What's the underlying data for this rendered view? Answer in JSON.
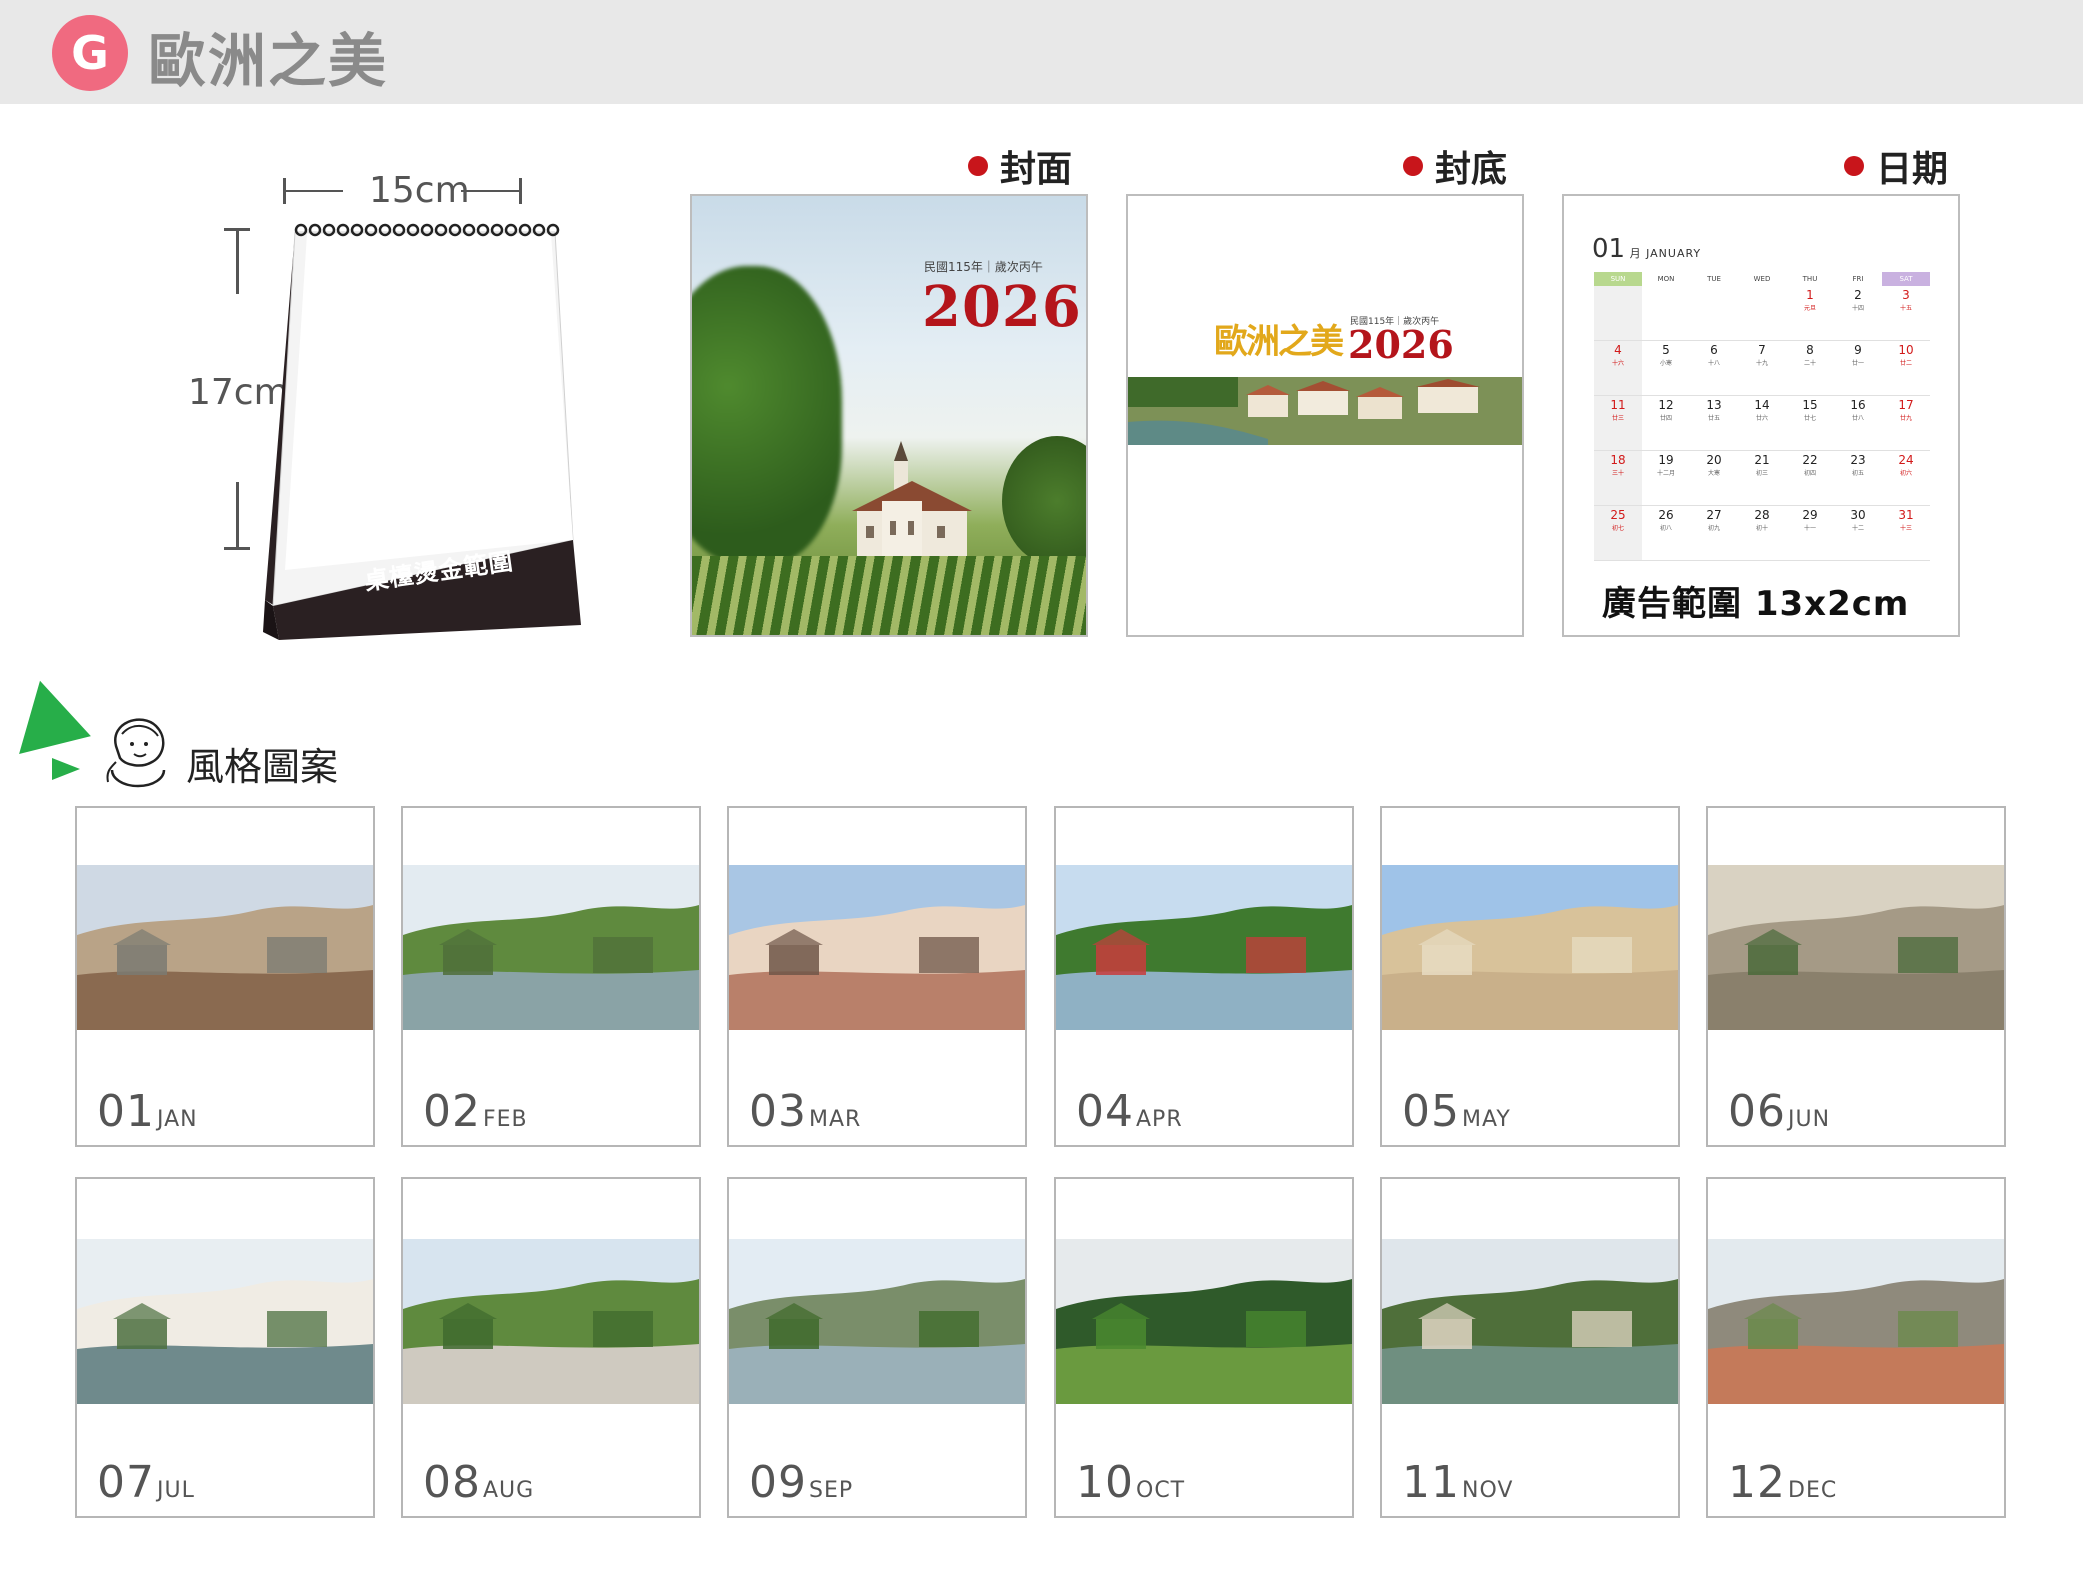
{
  "header": {
    "badge": "G",
    "title": "歐洲之美"
  },
  "dimensions": {
    "width": "15cm",
    "height": "17cm"
  },
  "stand": {
    "label": "桌檯燙金範圍"
  },
  "labels": {
    "cover": "封面",
    "back": "封底",
    "date": "日期"
  },
  "cover": {
    "subtitle": "民國115年｜歲次丙午",
    "year": "2026"
  },
  "back": {
    "brand": "歐洲之美",
    "subtitle": "民國115年｜歲次丙午",
    "year": "2026"
  },
  "date_page": {
    "month_num": "01",
    "month_cn": "月",
    "month_en": "JANUARY",
    "weekdays": [
      "SUN",
      "MON",
      "TUE",
      "WED",
      "THU",
      "FRI",
      "SAT"
    ],
    "weeks": [
      [
        {
          "d": "",
          "l": ""
        },
        {
          "d": "",
          "l": ""
        },
        {
          "d": "",
          "l": ""
        },
        {
          "d": "",
          "l": ""
        },
        {
          "d": "1",
          "l": "元旦",
          "red": true
        },
        {
          "d": "2",
          "l": "十四"
        },
        {
          "d": "3",
          "l": "十五",
          "red": true
        }
      ],
      [
        {
          "d": "4",
          "l": "十六",
          "red": true
        },
        {
          "d": "5",
          "l": "小寒"
        },
        {
          "d": "6",
          "l": "十八"
        },
        {
          "d": "7",
          "l": "十九"
        },
        {
          "d": "8",
          "l": "二十"
        },
        {
          "d": "9",
          "l": "廿一"
        },
        {
          "d": "10",
          "l": "廿二",
          "red": true
        }
      ],
      [
        {
          "d": "11",
          "l": "廿三",
          "red": true
        },
        {
          "d": "12",
          "l": "廿四"
        },
        {
          "d": "13",
          "l": "廿五"
        },
        {
          "d": "14",
          "l": "廿六"
        },
        {
          "d": "15",
          "l": "廿七"
        },
        {
          "d": "16",
          "l": "廿八"
        },
        {
          "d": "17",
          "l": "廿九",
          "red": true
        }
      ],
      [
        {
          "d": "18",
          "l": "三十",
          "red": true
        },
        {
          "d": "19",
          "l": "十二月"
        },
        {
          "d": "20",
          "l": "大寒"
        },
        {
          "d": "21",
          "l": "初三"
        },
        {
          "d": "22",
          "l": "初四"
        },
        {
          "d": "23",
          "l": "初五"
        },
        {
          "d": "24",
          "l": "初六",
          "red": true
        }
      ],
      [
        {
          "d": "25",
          "l": "初七",
          "red": true
        },
        {
          "d": "26",
          "l": "初八"
        },
        {
          "d": "27",
          "l": "初九"
        },
        {
          "d": "28",
          "l": "初十"
        },
        {
          "d": "29",
          "l": "十一"
        },
        {
          "d": "30",
          "l": "十二"
        },
        {
          "d": "31",
          "l": "十三",
          "red": true
        }
      ]
    ],
    "ad": "廣告範圍 13x2cm"
  },
  "style": {
    "title": "風格圖案"
  },
  "months": [
    {
      "num": "01",
      "abbr": "JAN"
    },
    {
      "num": "02",
      "abbr": "FEB"
    },
    {
      "num": "03",
      "abbr": "MAR"
    },
    {
      "num": "04",
      "abbr": "APR"
    },
    {
      "num": "05",
      "abbr": "MAY"
    },
    {
      "num": "06",
      "abbr": "JUN"
    },
    {
      "num": "07",
      "abbr": "JUL"
    },
    {
      "num": "08",
      "abbr": "AUG"
    },
    {
      "num": "09",
      "abbr": "SEP"
    },
    {
      "num": "10",
      "abbr": "OCT"
    },
    {
      "num": "11",
      "abbr": "NOV"
    },
    {
      "num": "12",
      "abbr": "DEC"
    }
  ]
}
